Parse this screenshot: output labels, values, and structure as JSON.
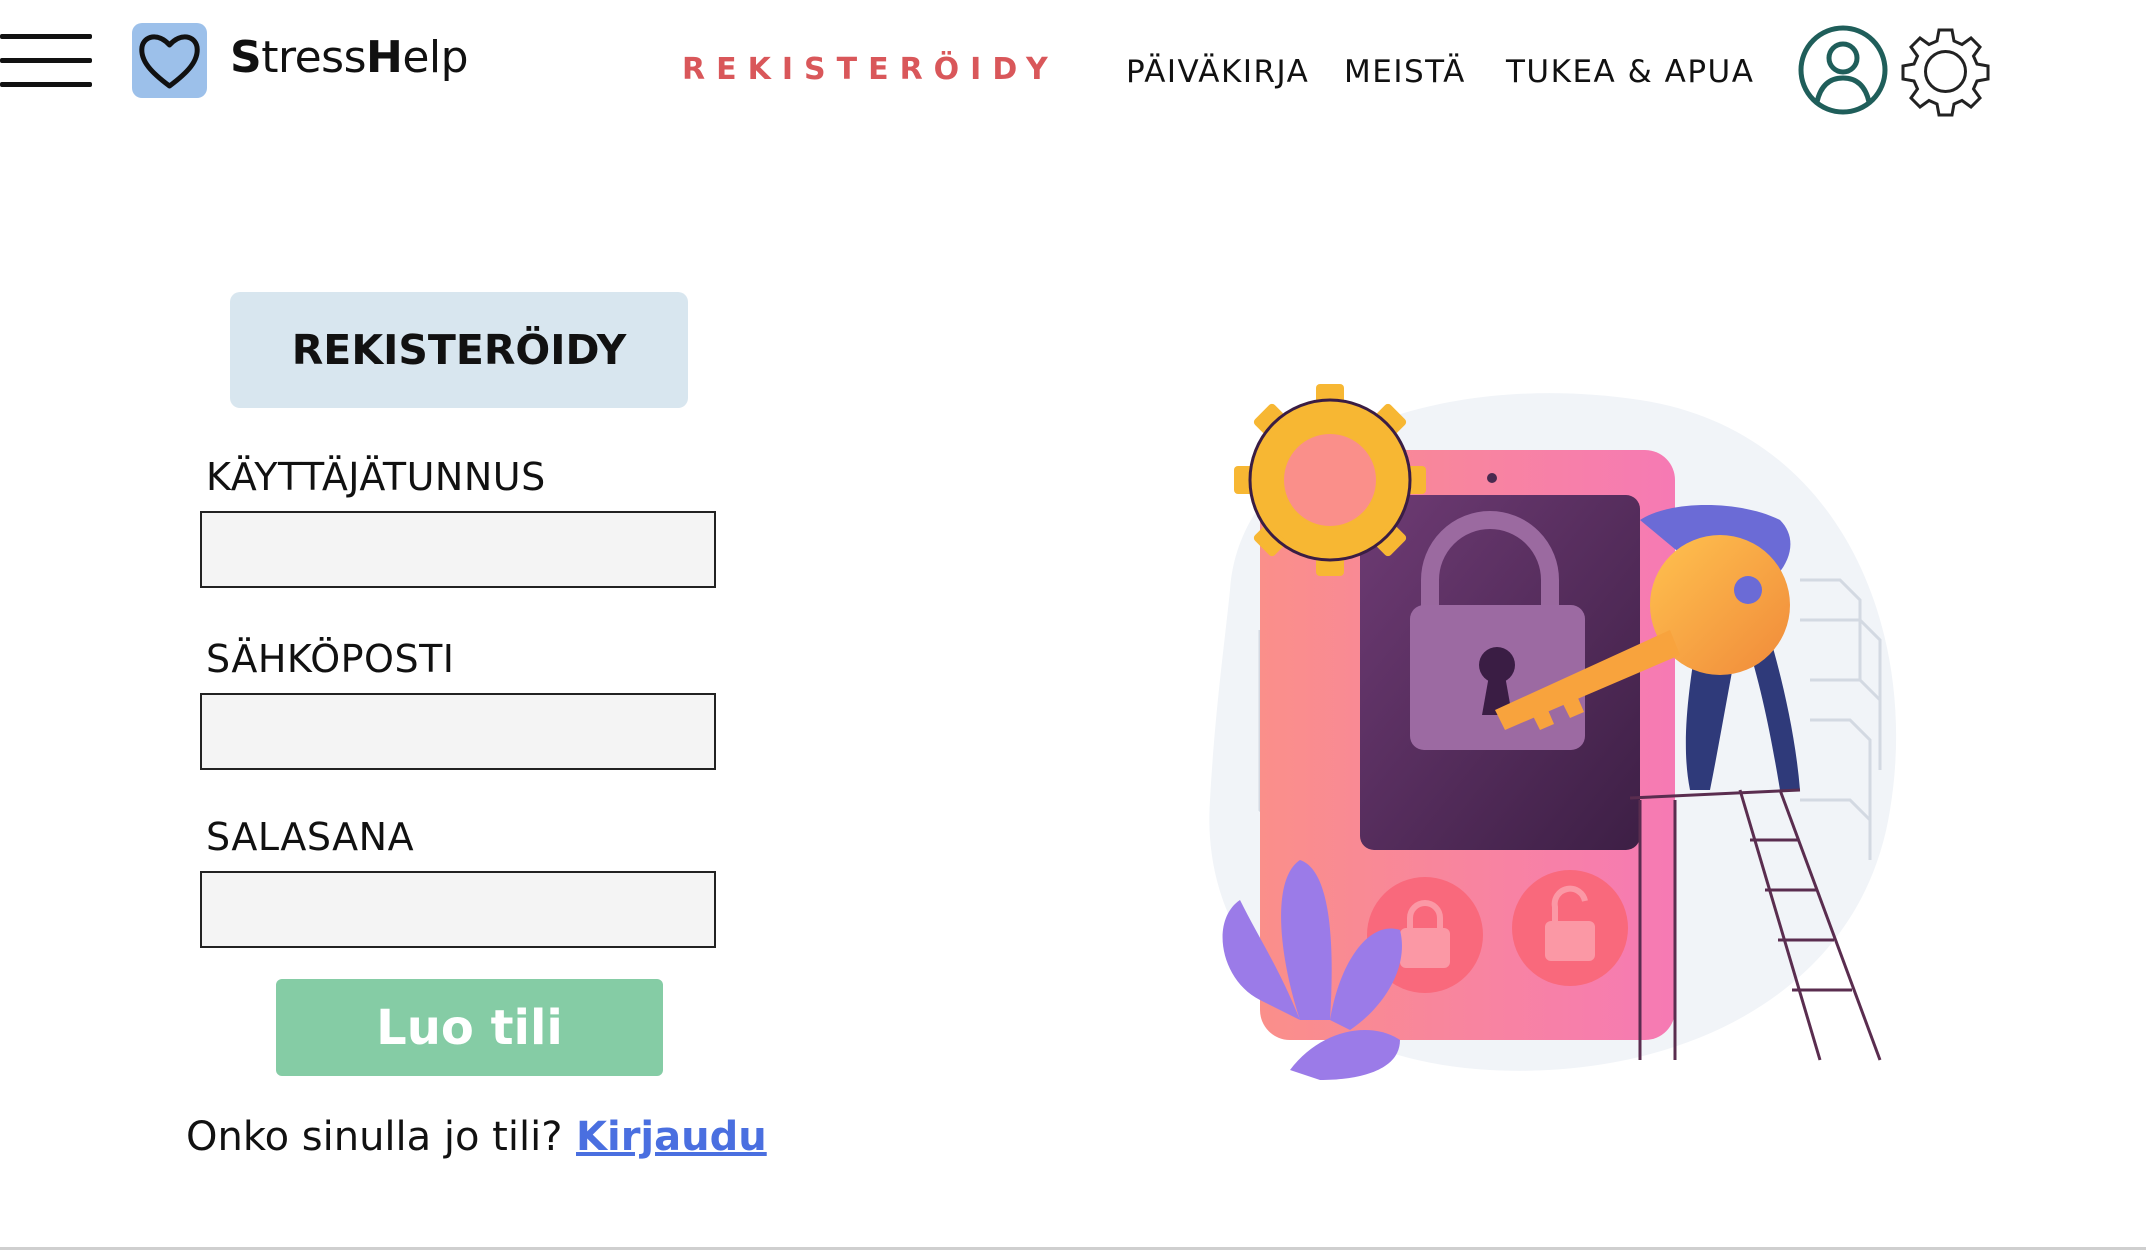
{
  "header": {
    "brand_first": "S",
    "brand_rest": "tress",
    "brand_h": "H",
    "brand_end": "elp",
    "nav": {
      "register": "REKISTERÖIDY",
      "diary": "PÄIVÄKIRJA",
      "about": "MEISTÄ",
      "support": "TUKEA & APUA"
    },
    "icons": [
      "menu-icon",
      "heart-icon",
      "user-icon",
      "gear-icon"
    ]
  },
  "form": {
    "heading": "REKISTERÖIDY",
    "username_label": "KÄYTTÄJÄTUNNUS",
    "username_value": "",
    "email_label": "SÄHKÖPOSTI",
    "email_value": "",
    "password_label": "SALASANA",
    "password_value": "",
    "submit_label": "Luo tili",
    "login_prompt": "Onko sinulla jo tili?",
    "login_link": "Kirjaudu"
  },
  "colors": {
    "accent_register": "#d9575a",
    "logo_badge": "#9cc0ea",
    "heading_bg": "#d8e6ef",
    "submit_bg": "#85cca5",
    "link": "#4a6fe0",
    "user_icon": "#1f5e5a"
  }
}
